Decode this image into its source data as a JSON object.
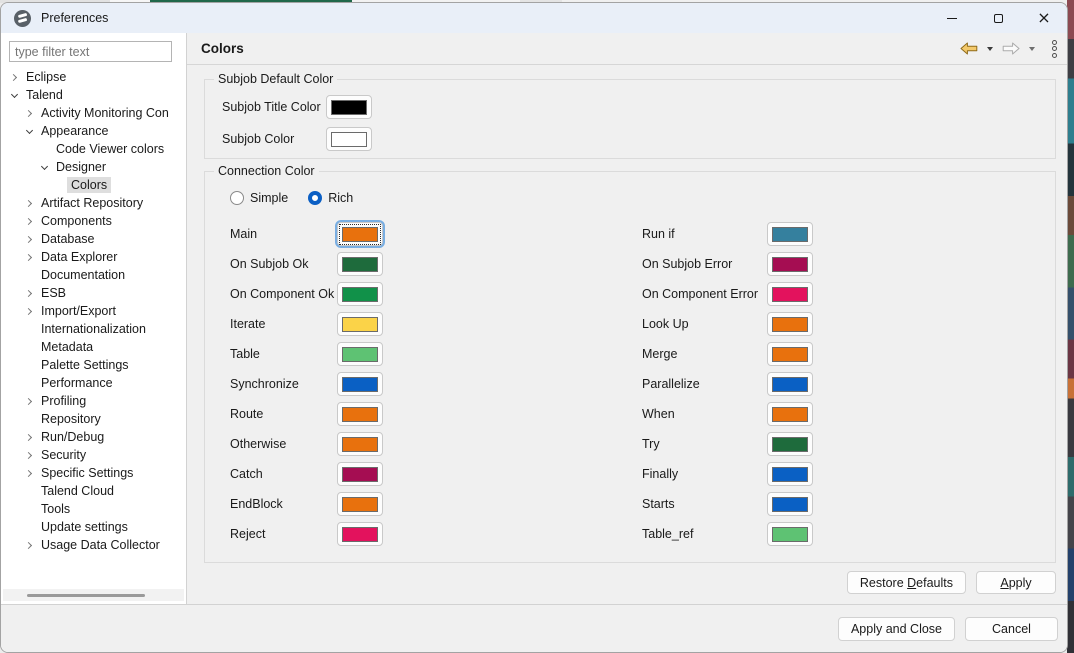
{
  "window": {
    "title": "Preferences"
  },
  "sidebar": {
    "filter_placeholder": "type filter text",
    "tree": [
      {
        "label": "Eclipse",
        "level": 0,
        "state": "collapsed"
      },
      {
        "label": "Talend",
        "level": 0,
        "state": "expanded"
      },
      {
        "label": "Activity Monitoring Con",
        "level": 1,
        "state": "collapsed"
      },
      {
        "label": "Appearance",
        "level": 1,
        "state": "expanded"
      },
      {
        "label": "Code Viewer colors",
        "level": 2,
        "state": "leaf"
      },
      {
        "label": "Designer",
        "level": 2,
        "state": "expanded"
      },
      {
        "label": "Colors",
        "level": 3,
        "state": "leaf",
        "selected": true
      },
      {
        "label": "Artifact Repository",
        "level": 1,
        "state": "collapsed"
      },
      {
        "label": "Components",
        "level": 1,
        "state": "collapsed"
      },
      {
        "label": "Database",
        "level": 1,
        "state": "collapsed"
      },
      {
        "label": "Data Explorer",
        "level": 1,
        "state": "collapsed"
      },
      {
        "label": "Documentation",
        "level": 1,
        "state": "leaf"
      },
      {
        "label": "ESB",
        "level": 1,
        "state": "collapsed"
      },
      {
        "label": "Import/Export",
        "level": 1,
        "state": "collapsed"
      },
      {
        "label": "Internationalization",
        "level": 1,
        "state": "leaf"
      },
      {
        "label": "Metadata",
        "level": 1,
        "state": "leaf"
      },
      {
        "label": "Palette Settings",
        "level": 1,
        "state": "leaf"
      },
      {
        "label": "Performance",
        "level": 1,
        "state": "leaf"
      },
      {
        "label": "Profiling",
        "level": 1,
        "state": "collapsed"
      },
      {
        "label": "Repository",
        "level": 1,
        "state": "leaf"
      },
      {
        "label": "Run/Debug",
        "level": 1,
        "state": "collapsed"
      },
      {
        "label": "Security",
        "level": 1,
        "state": "collapsed"
      },
      {
        "label": "Specific Settings",
        "level": 1,
        "state": "collapsed"
      },
      {
        "label": "Talend Cloud",
        "level": 1,
        "state": "leaf"
      },
      {
        "label": "Tools",
        "level": 1,
        "state": "leaf"
      },
      {
        "label": "Update settings",
        "level": 1,
        "state": "leaf"
      },
      {
        "label": "Usage Data Collector",
        "level": 1,
        "state": "collapsed"
      }
    ]
  },
  "header": {
    "title": "Colors"
  },
  "subjob_group": {
    "title": "Subjob Default Color",
    "rows": [
      {
        "label": "Subjob Title Color",
        "color": "#000000"
      },
      {
        "label": "Subjob Color",
        "color": "#FFFFFF"
      }
    ]
  },
  "connection_group": {
    "title": "Connection Color",
    "radios": [
      {
        "label": "Simple",
        "selected": false
      },
      {
        "label": "Rich",
        "selected": true
      }
    ],
    "left": [
      {
        "label": "Main",
        "color": "#E8710D",
        "focused": true
      },
      {
        "label": "On Subjob Ok",
        "color": "#1E6B3C"
      },
      {
        "label": "On Component Ok",
        "color": "#119149"
      },
      {
        "label": "Iterate",
        "color": "#FBD348"
      },
      {
        "label": "Table",
        "color": "#5EC273"
      },
      {
        "label": "Synchronize",
        "color": "#0A60C4"
      },
      {
        "label": "Route",
        "color": "#E8710D"
      },
      {
        "label": "Otherwise",
        "color": "#E8710D"
      },
      {
        "label": "Catch",
        "color": "#A50D52"
      },
      {
        "label": "EndBlock",
        "color": "#E8710D"
      },
      {
        "label": "Reject",
        "color": "#E3125D"
      }
    ],
    "right": [
      {
        "label": "Run if",
        "color": "#35809E"
      },
      {
        "label": "On Subjob Error",
        "color": "#A50D52"
      },
      {
        "label": "On Component Error",
        "color": "#E3125D"
      },
      {
        "label": "Look Up",
        "color": "#E8710D"
      },
      {
        "label": "Merge",
        "color": "#E8710D"
      },
      {
        "label": "Parallelize",
        "color": "#0A60C4"
      },
      {
        "label": "When",
        "color": "#E8710D"
      },
      {
        "label": "Try",
        "color": "#1E6B3C"
      },
      {
        "label": "Finally",
        "color": "#0A60C4"
      },
      {
        "label": "Starts",
        "color": "#0A60C4"
      },
      {
        "label": "Table_ref",
        "color": "#5EC273"
      }
    ]
  },
  "footer": {
    "restore_defaults": {
      "pre": "Restore ",
      "key": "D",
      "post": "efaults"
    },
    "apply": {
      "pre": "",
      "key": "A",
      "post": "pply"
    },
    "apply_and_close": "Apply and Close",
    "cancel": "Cancel"
  }
}
